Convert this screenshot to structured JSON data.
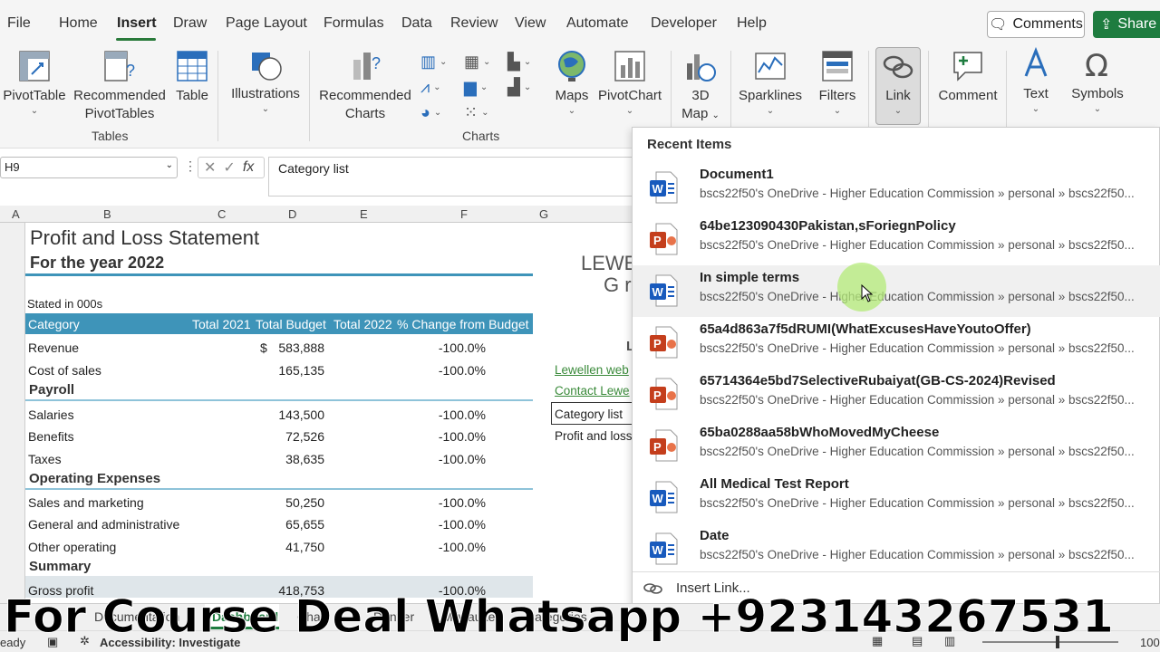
{
  "menu": {
    "items": [
      "File",
      "Home",
      "Insert",
      "Draw",
      "Page Layout",
      "Formulas",
      "Data",
      "Review",
      "View",
      "Automate",
      "Developer",
      "Help"
    ],
    "active": "Insert",
    "comments_label": "Comments",
    "share_label": "Share"
  },
  "ribbon": {
    "pivottable": "PivotTable",
    "recommended_pivottables_1": "Recommended",
    "recommended_pivottables_2": "PivotTables",
    "table": "Table",
    "tables_group": "Tables",
    "illustrations": "Illustrations",
    "recommended_charts_1": "Recommended",
    "recommended_charts_2": "Charts",
    "charts_group": "Charts",
    "maps": "Maps",
    "pivotchart": "PivotChart",
    "map3d_1": "3D",
    "map3d_2": "Map",
    "sparklines": "Sparklines",
    "filters": "Filters",
    "link": "Link",
    "comment": "Comment",
    "text": "Text",
    "symbols": "Symbols"
  },
  "formula_bar": {
    "name_box": "H9",
    "value": "Category list"
  },
  "columns": [
    "A",
    "B",
    "C",
    "D",
    "E",
    "F",
    "G"
  ],
  "sheet": {
    "title": "Profit and Loss Statement",
    "subtitle": "For the year 2022",
    "stated": "Stated in 000s",
    "headers": [
      "Category",
      "Total 2021",
      "Total Budget",
      "Total 2022",
      "% Change from Budget"
    ],
    "revenue": {
      "label": "Revenue",
      "currency": "$",
      "budget": "583,888",
      "change": "-100.0%"
    },
    "cost_of_sales": {
      "label": "Cost of sales",
      "budget": "165,135",
      "change": "-100.0%"
    },
    "payroll": "Payroll",
    "salaries": {
      "label": "Salaries",
      "budget": "143,500",
      "change": "-100.0%"
    },
    "benefits": {
      "label": "Benefits",
      "budget": "72,526",
      "change": "-100.0%"
    },
    "taxes": {
      "label": "Taxes",
      "budget": "38,635",
      "change": "-100.0%"
    },
    "opex": "Operating Expenses",
    "sales_marketing": {
      "label": "Sales and marketing",
      "budget": "50,250",
      "change": "-100.0%"
    },
    "general_admin": {
      "label": "General and administrative",
      "budget": "65,655",
      "change": "-100.0%"
    },
    "other_operating": {
      "label": "Other operating",
      "budget": "41,750",
      "change": "-100.0%"
    },
    "summary": "Summary",
    "gross_profit": {
      "label": "Gross profit",
      "budget": "418,753",
      "change": "-100.0%"
    },
    "right_panel": {
      "company_line1": "LEWE",
      "company_line2": "G r",
      "letter_l": "L",
      "link_web": "Lewellen web",
      "link_contact": "Contact Lewe",
      "category_list": "Category list",
      "profit_loss": "Profit and loss"
    }
  },
  "dropdown": {
    "header": "Recent Items",
    "items": [
      {
        "name": "Document1",
        "type": "word",
        "path": "bscs22f50's OneDrive - Higher Education Commission » personal » bscs22f50..."
      },
      {
        "name": "64be123090430Pakistan,sForiegnPolicy",
        "type": "ppt",
        "path": "bscs22f50's OneDrive - Higher Education Commission » personal » bscs22f50..."
      },
      {
        "name": "In simple terms",
        "type": "word",
        "path": "bscs22f50's OneDrive - Higher Education Commission » personal » bscs22f50..."
      },
      {
        "name": "65a4d863a7f5dRUMI(WhatExcusesHaveYoutoOffer)",
        "type": "ppt",
        "path": "bscs22f50's OneDrive - Higher Education Commission » personal » bscs22f50..."
      },
      {
        "name": "65714364e5bd7SelectiveRubaiyat(GB-CS-2024)Revised",
        "type": "ppt",
        "path": "bscs22f50's OneDrive - Higher Education Commission » personal » bscs22f50..."
      },
      {
        "name": "65ba0288aa58bWhoMovedMyCheese",
        "type": "ppt",
        "path": "bscs22f50's OneDrive - Higher Education Commission » personal » bscs22f50..."
      },
      {
        "name": "All Medical Test Report",
        "type": "word",
        "path": "bscs22f50's OneDrive - Higher Education Commission » personal » bscs22f50..."
      },
      {
        "name": "Date",
        "type": "word",
        "path": "bscs22f50's OneDrive - Higher Education Commission » personal » bscs22f50..."
      }
    ],
    "insert_link": "Insert Link..."
  },
  "tabs": [
    "Documentation",
    "Dashboard",
    "Chart",
    "Denver",
    "Milwaukee",
    "Categories"
  ],
  "status": {
    "ready": "eady",
    "accessibility": "Accessibility: Investigate",
    "zoom": "100"
  },
  "watermark": "For Course Deal Whatsapp +923143267531",
  "colors": {
    "accent_green": "#1e7c3f",
    "header_blue": "#3e94b9",
    "word_blue": "#185abd",
    "ppt_red": "#c43e1c"
  }
}
